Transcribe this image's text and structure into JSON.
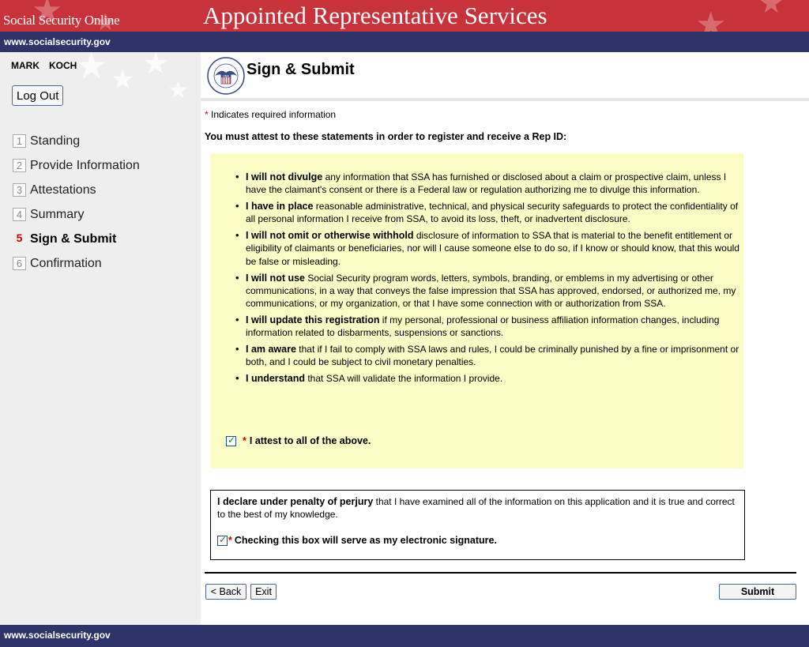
{
  "header": {
    "brand": "Social Security Online",
    "app_title": "Appointed Representative Services",
    "url": "www.socialsecurity.gov"
  },
  "sidebar": {
    "user_first": "MARK",
    "user_last": "KOCH",
    "logout_label": "Log Out",
    "steps": [
      {
        "num": "1",
        "label": "Standing"
      },
      {
        "num": "2",
        "label": "Provide Information"
      },
      {
        "num": "3",
        "label": "Attestations"
      },
      {
        "num": "4",
        "label": "Summary"
      },
      {
        "num": "5",
        "label": "Sign & Submit"
      },
      {
        "num": "6",
        "label": "Confirmation"
      }
    ],
    "active_step": 5
  },
  "page": {
    "title": "Sign & Submit",
    "required_marker": "*",
    "required_note": "Indicates required information",
    "intro": "You must attest to these statements in order to register and receive a Rep ID:",
    "seal_text": "SOCIAL SECURITY ADMINISTRATION",
    "seal_usa": "USA"
  },
  "attestations": [
    {
      "bold": "I will not divulge",
      "text": " any information that SSA has furnished or disclosed about a claim or prospective claim, unless I have the claimant's consent or there is a Federal law or regulation authorizing me to divulge this information."
    },
    {
      "bold": "I have in place",
      "text": " reasonable administrative, technical, and physical security safeguards to protect the confidentiality of all personal information I receive from SSA, to avoid its loss, theft, or inadvertent disclosure."
    },
    {
      "bold": "I will not omit or otherwise withhold",
      "text": " disclosure of information to SSA that is material to the benefit entitlement or eligibility of claimants or beneficiaries, nor will I cause someone else to do so, if I know or should know, that this would be false or misleading."
    },
    {
      "bold": "I will not use",
      "text": " Social Security program words, letters, symbols, branding, or emblems in my advertising or other communications, in a way that conveys the false impression that SSA has approved, endorsed, or authorized me, my communications, or my organization, or that I have some connection with or authorization from SSA."
    },
    {
      "bold": "I will update this registration",
      "text": " if my personal, professional or business affiliation information changes, including information related to disbarments, suspensions or sanctions."
    },
    {
      "bold": "I am aware",
      "text": " that if I fail to comply with SSA laws and rules, I could be criminally punished by a fine or imprisonment or both, and I could be subject to civil monetary penalties."
    },
    {
      "bold": "I understand",
      "text": " that SSA will validate the information I provide."
    }
  ],
  "attest_checkbox": {
    "checked": true,
    "label": "I attest to all of the above."
  },
  "perjury": {
    "bold": "I declare under penalty of perjury",
    "text": " that I have examined all of the information on this application and it is true and correct to the best of my knowledge.",
    "checkbox_checked": true,
    "checkbox_label": "Checking this box will serve as my electronic signature."
  },
  "buttons": {
    "back": "< Back",
    "exit": "Exit",
    "submit": "Submit"
  },
  "footer": {
    "url": "www.socialsecurity.gov"
  },
  "colors": {
    "header_red": "#c8323a",
    "navy": "#2e3467",
    "attest_bg": "#fbfbc6",
    "required_red": "#d00000"
  },
  "icons": {
    "logo": "ssa-seal-icon",
    "check": "checkmark-icon",
    "star": "star-icon"
  }
}
